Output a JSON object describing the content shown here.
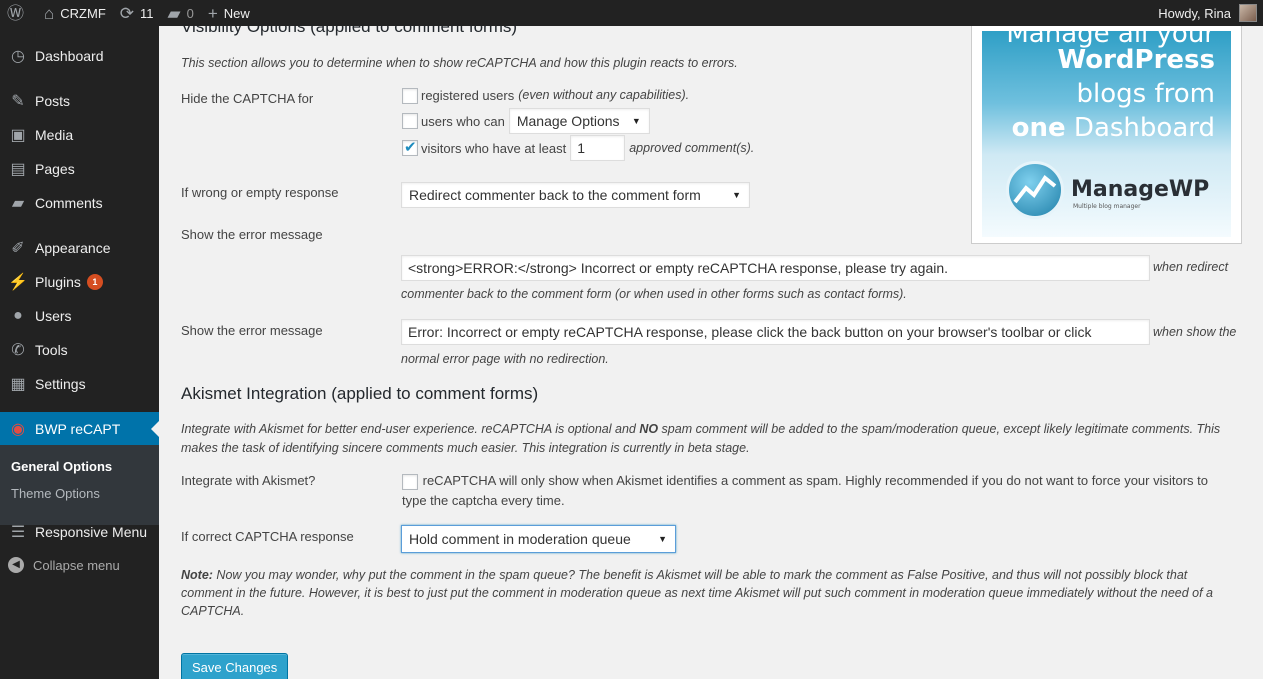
{
  "adminbar": {
    "site_name": "CRZMF",
    "updates_count": "11",
    "comments_count": "0",
    "new_label": "New",
    "howdy": "Howdy, Rina"
  },
  "sidebar": {
    "items": [
      {
        "label": "Dashboard",
        "icon": "dashboard-icon"
      },
      {
        "label": "Posts",
        "icon": "pin-icon"
      },
      {
        "label": "Media",
        "icon": "media-icon"
      },
      {
        "label": "Pages",
        "icon": "pages-icon"
      },
      {
        "label": "Comments",
        "icon": "comment-icon"
      },
      {
        "label": "Appearance",
        "icon": "brush-icon"
      },
      {
        "label": "Plugins",
        "icon": "plug-icon",
        "badge": "1"
      },
      {
        "label": "Users",
        "icon": "user-icon"
      },
      {
        "label": "Tools",
        "icon": "wrench-icon"
      },
      {
        "label": "Settings",
        "icon": "sliders-icon"
      },
      {
        "label": "BWP reCAPT",
        "icon": "recaptcha-icon"
      },
      {
        "label": "Responsive Menu",
        "icon": "menu-icon"
      }
    ],
    "submenu": [
      "General Options",
      "Theme Options"
    ],
    "collapse": "Collapse menu"
  },
  "visibility": {
    "heading": "Visibility Options (applied to comment forms)",
    "description": "This section allows you to determine when to show reCAPTCHA and how this plugin reacts to errors.",
    "hide_label": "Hide the CAPTCHA for",
    "registered_users": "registered users",
    "registered_users_note": "(even without any capabilities).",
    "users_who_can": "users who can",
    "capability_select": "Manage Options",
    "visitors_label": "visitors who have at least",
    "visitors_count": "1",
    "approved_label": "approved comment(s).",
    "wrong_label": "If wrong or empty response",
    "wrong_select": "Redirect commenter back to the comment form",
    "error_label_1": "Show the error message",
    "error_value_1": "<strong>ERROR:</strong> Incorrect or empty reCAPTCHA response, please try again.",
    "error_note_1a": "when redirect",
    "error_note_1b": "commenter back to the comment form (or when used in other forms such as contact forms).",
    "error_label_2": "Show the error message",
    "error_value_2": "Error: Incorrect or empty reCAPTCHA response, please click the back button on your browser's toolbar or click",
    "error_note_2a": "when show the",
    "error_note_2b": "normal error page with no redirection."
  },
  "akismet": {
    "heading": "Akismet Integration (applied to comment forms)",
    "desc_before": "Integrate with Akismet for better end-user experience. reCAPTCHA is optional and ",
    "desc_strong": "NO",
    "desc_after": " spam comment will be added to the spam/moderation queue, except likely legitimate comments. This",
    "desc_line2": "makes the task of identifying sincere comments much easier. This integration is currently in beta stage.",
    "integrate_label": "Integrate with Akismet?",
    "integrate_text_1": "reCAPTCHA will only show when Akismet identifies a comment as spam. Highly recommended if you do not want to force your visitors to",
    "integrate_text_2": "type the captcha every time.",
    "correct_label": "If correct CAPTCHA response",
    "correct_select": "Hold comment in moderation queue",
    "note_strong": "Note:",
    "note_line1": " Now you may wonder, why put the comment in the spam queue? The benefit is Akismet will be able to mark the comment as False Positive, and thus will not possibly block that",
    "note_line2": "comment in the future. However, it is best to just put the comment in moderation queue as next time Akismet will put such comment in moderation queue immediately without the need of a",
    "note_line3": "CAPTCHA."
  },
  "save_button": "Save Changes",
  "ad": {
    "line1": "Manage all your",
    "line2": "WordPress",
    "line3": "blogs from",
    "line4a": "one",
    "line4b": " Dashboard",
    "logo": "ManageWP",
    "tagline": "Multiple blog manager"
  },
  "colors": {
    "accent": "#0073aa",
    "button": "#2ea2cc",
    "badge": "#d54e21"
  }
}
